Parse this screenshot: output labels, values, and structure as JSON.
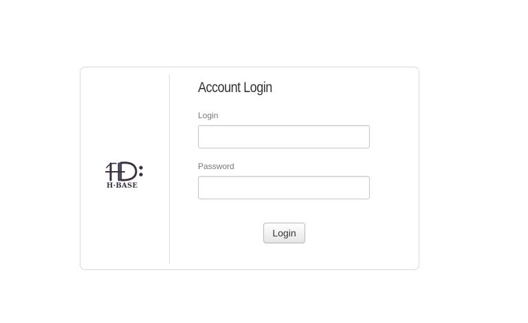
{
  "logo": {
    "name": "hbase-logo-icon",
    "text": "H·BASE",
    "color": "#3a3040"
  },
  "form": {
    "title": "Account Login",
    "login_label": "Login",
    "login_value": "",
    "password_label": "Password",
    "password_value": "",
    "submit_label": "Login"
  }
}
